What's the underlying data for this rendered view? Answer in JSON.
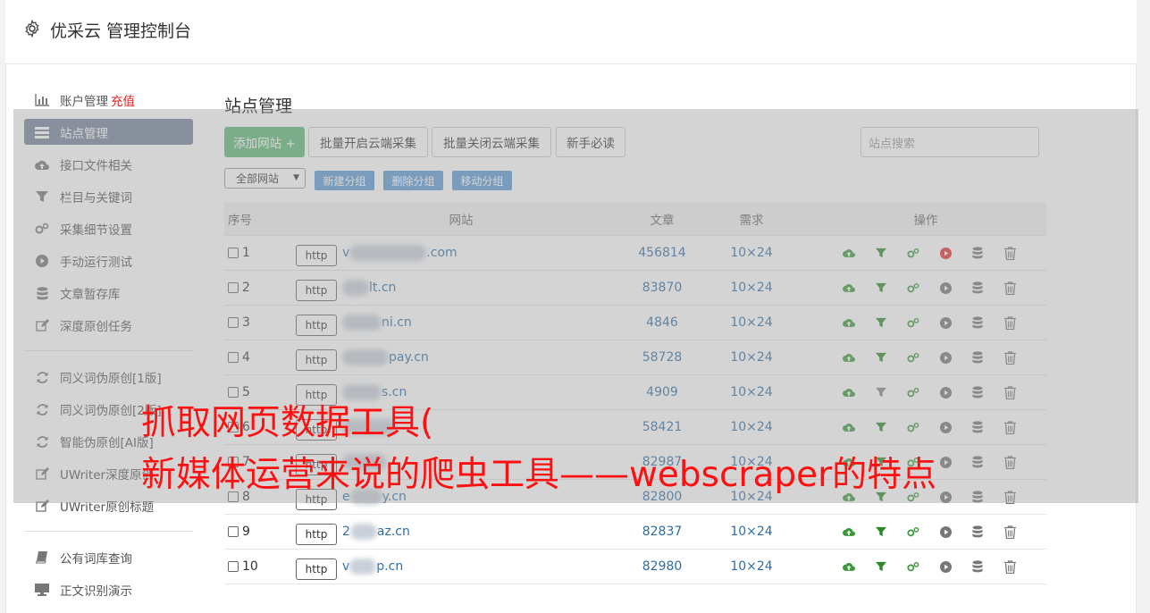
{
  "app": {
    "title": "优采云 管理控制台"
  },
  "sidebar": {
    "group1": [
      {
        "icon": "bar-chart-icon",
        "label": "账户管理",
        "extra": "充值"
      },
      {
        "icon": "list-icon",
        "label": "站点管理",
        "active": true
      },
      {
        "icon": "cloud-upload-icon",
        "label": "接口文件相关"
      },
      {
        "icon": "filter-icon",
        "label": "栏目与关键词"
      },
      {
        "icon": "gears-icon",
        "label": "采集细节设置"
      },
      {
        "icon": "play-circle-icon",
        "label": "手动运行测试"
      },
      {
        "icon": "database-icon",
        "label": "文章暂存库"
      },
      {
        "icon": "edit-icon",
        "label": "深度原创任务"
      }
    ],
    "group2": [
      {
        "icon": "refresh-icon",
        "label": "同义词伪原创[1版]"
      },
      {
        "icon": "refresh-icon",
        "label": "同义词伪原创[2版]"
      },
      {
        "icon": "refresh-icon",
        "label": "智能伪原创[AI版]"
      },
      {
        "icon": "edit-icon",
        "label": "UWriter深度原创"
      },
      {
        "icon": "edit-icon",
        "label": "UWriter原创标题"
      }
    ],
    "group3": [
      {
        "icon": "book-icon",
        "label": "公有词库查询"
      },
      {
        "icon": "monitor-icon",
        "label": "正文识别演示"
      }
    ]
  },
  "main": {
    "title": "站点管理",
    "add_site": "添加网站 +",
    "batch_on": "批量开启云端采集",
    "batch_off": "批量关闭云端采集",
    "newbie": "新手必读",
    "search_placeholder": "站点搜索",
    "group_select": "全部网站",
    "new_group": "新建分组",
    "delete_group": "删除分组",
    "move_group": "移动分组"
  },
  "table": {
    "headers": {
      "no": "序号",
      "site": "网站",
      "articles": "文章",
      "demand": "需求",
      "ops": "操作"
    },
    "rows": [
      {
        "no": "1",
        "http": "http",
        "pre": "v",
        "post": ".com",
        "articles": "456814",
        "demand": "10×24",
        "running": true
      },
      {
        "no": "2",
        "http": "http",
        "pre": "",
        "post": "lt.cn",
        "articles": "83870",
        "demand": "10×24"
      },
      {
        "no": "3",
        "http": "http",
        "pre": "",
        "post": "ni.cn",
        "articles": "4846",
        "demand": "10×24"
      },
      {
        "no": "4",
        "http": "http",
        "pre": "",
        "post": "pay.cn",
        "articles": "58728",
        "demand": "10×24"
      },
      {
        "no": "5",
        "http": "http",
        "pre": "",
        "post": "s.cn",
        "articles": "4909",
        "demand": "10×24",
        "filter_gray": true
      },
      {
        "no": "6",
        "http": "http",
        "pre": "",
        "post": "",
        "articles": "58421",
        "demand": "10×24"
      },
      {
        "no": "7",
        "http": "http",
        "pre": "",
        "post": "",
        "articles": "82987",
        "demand": "10×24"
      },
      {
        "no": "8",
        "http": "http",
        "pre": "e",
        "post": "y.cn",
        "articles": "82800",
        "demand": "10×24"
      },
      {
        "no": "9",
        "http": "http",
        "pre": "2",
        "post": "az.cn",
        "articles": "82837",
        "demand": "10×24"
      },
      {
        "no": "10",
        "http": "http",
        "pre": "v",
        "post": "p.cn",
        "articles": "82980",
        "demand": "10×24"
      }
    ]
  },
  "overlay_caption": {
    "line1": "抓取网页数据工具(",
    "line2": "新媒体运营来说的爬虫工具——webscraper的特点"
  },
  "colors": {
    "green": "#5fb878",
    "link": "#2e6da4",
    "red": "#e02020",
    "caption": "#ff1010"
  }
}
